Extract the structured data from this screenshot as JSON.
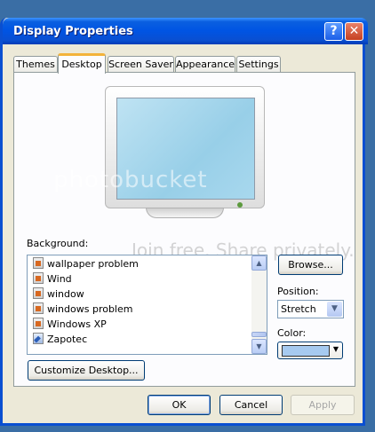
{
  "window": {
    "title": "Display Properties",
    "help_glyph": "?",
    "close_glyph": "✕"
  },
  "tabs": [
    {
      "label": "Themes"
    },
    {
      "label": "Desktop"
    },
    {
      "label": "Screen Saver"
    },
    {
      "label": "Appearance"
    },
    {
      "label": "Settings"
    }
  ],
  "background": {
    "label": "Background:",
    "items": [
      {
        "label": "wallpaper problem",
        "icon": "image-file-icon"
      },
      {
        "label": "Wind",
        "icon": "image-file-icon"
      },
      {
        "label": "window",
        "icon": "image-file-icon"
      },
      {
        "label": "windows problem",
        "icon": "image-file-icon"
      },
      {
        "label": "Windows XP",
        "icon": "image-file-icon"
      },
      {
        "label": "Zapotec",
        "icon": "wallpaper-file-icon"
      }
    ]
  },
  "browse_label": "Browse...",
  "position": {
    "label": "Position:",
    "value": "Stretch"
  },
  "color": {
    "label": "Color:",
    "value": "#a6caf0"
  },
  "customize_label": "Customize Desktop...",
  "footer": {
    "ok": "OK",
    "cancel": "Cancel",
    "apply": "Apply"
  },
  "watermark": {
    "main": "photobucket",
    "sub": "Join free. Share privately."
  }
}
